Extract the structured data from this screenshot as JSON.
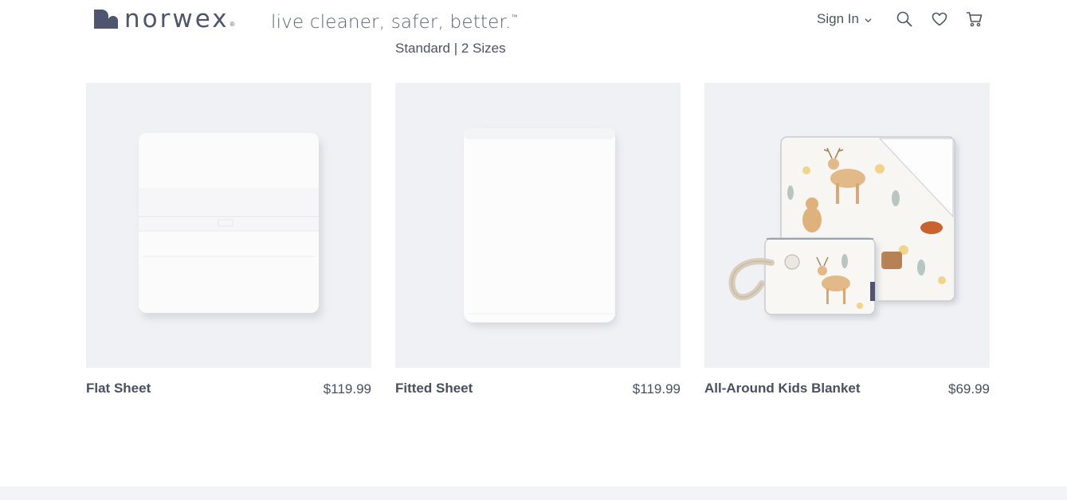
{
  "header": {
    "logo_text": "norwex",
    "logo_reg": "®",
    "tagline": "live cleaner, safer, better.",
    "tagline_tm": "™",
    "sign_in_label": "Sign In",
    "icons": [
      "search-icon",
      "heart-icon",
      "cart-icon"
    ]
  },
  "subtitle": "Standard | 2 Sizes",
  "products": [
    {
      "name": "Flat Sheet",
      "price": "$119.99",
      "image": "folded-flat-sheet"
    },
    {
      "name": "Fitted Sheet",
      "price": "$119.99",
      "image": "folded-fitted-sheet"
    },
    {
      "name": "All-Around Kids Blanket",
      "price": "$69.99",
      "image": "woodland-print-blanket-with-pouch"
    }
  ],
  "colors": {
    "text": "#4a4f63",
    "brand": "#4f5571",
    "image_bg": "#f0f1f5",
    "footer_bg": "#f3f4f8"
  }
}
